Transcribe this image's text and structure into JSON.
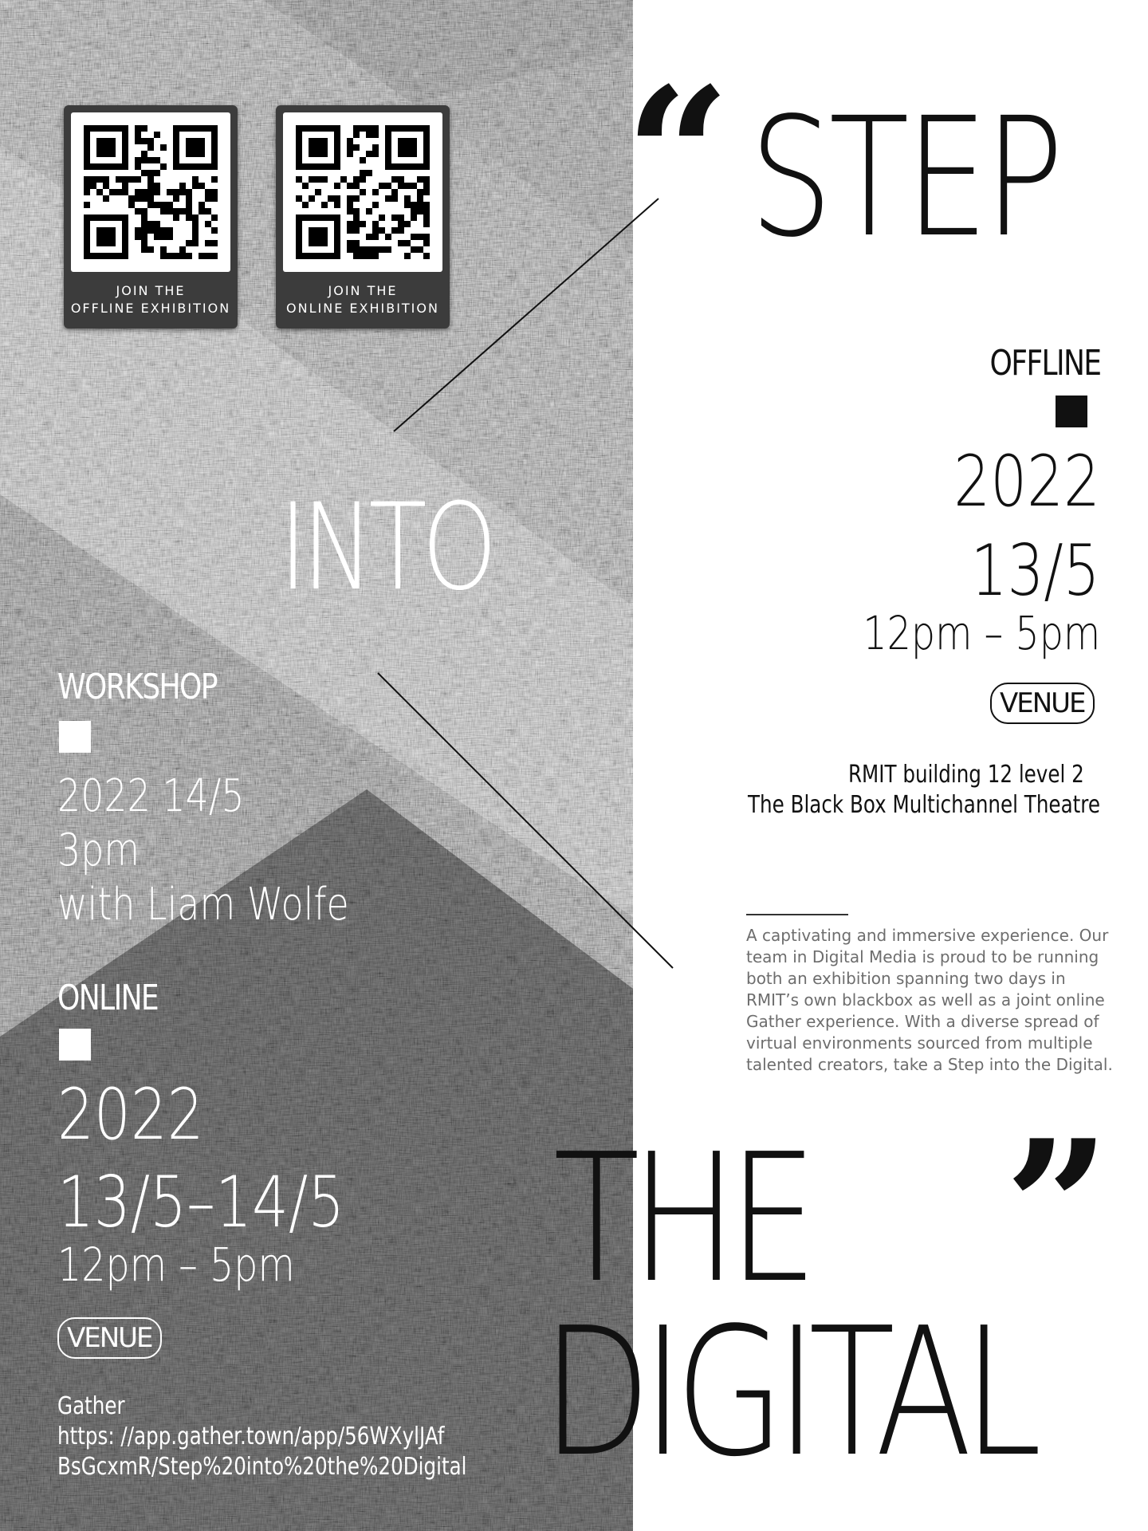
{
  "qr_cards": {
    "offline": {
      "line1": "JOIN THE",
      "line2": "OFFLINE EXHIBITION"
    },
    "online": {
      "line1": "JOIN THE",
      "line2": "ONLINE EXHIBITION"
    }
  },
  "title": {
    "open_quote": "“",
    "step": "STEP",
    "into": "INTO",
    "the": "THE",
    "digital": "DIGITAL",
    "close_quote": "”"
  },
  "offline": {
    "label": "OFFLINE",
    "year": "2022",
    "date": "13/5",
    "time": "12pm – 5pm",
    "venue_label": "VENUE",
    "venue_line1": "RMIT building 12 level 2",
    "venue_line2": "The Black Box Multichannel Theatre"
  },
  "workshop": {
    "label": "WORKSHOP",
    "date": "2022 14/5",
    "time": "3pm",
    "host": "with Liam Wolfe"
  },
  "online": {
    "label": "ONLINE",
    "year": "2022",
    "date": "13/5–14/5",
    "time": "12pm – 5pm",
    "venue_label": "VENUE",
    "platform": "Gather",
    "url_line1": "https: //app.gather.town/app/56WXylJAf",
    "url_line2": "BsGcxmR/Step%20into%20the%20Digital"
  },
  "description": "A captivating and immersive experience. Our team in Digital Media is proud to be running both an exhibition spanning two days in RMIT’s own blackbox as well as a joint online Gather experience. With a diverse spread of virtual environments sourced from multiple talented creators, take a Step into the Digital.",
  "colors": {
    "background": "#ffffff",
    "ink": "#111111",
    "texture_light": "#b8b8b8",
    "texture_dark": "#3a3a3a",
    "card": "#3c3c3c",
    "description": "#6d6d6d"
  }
}
